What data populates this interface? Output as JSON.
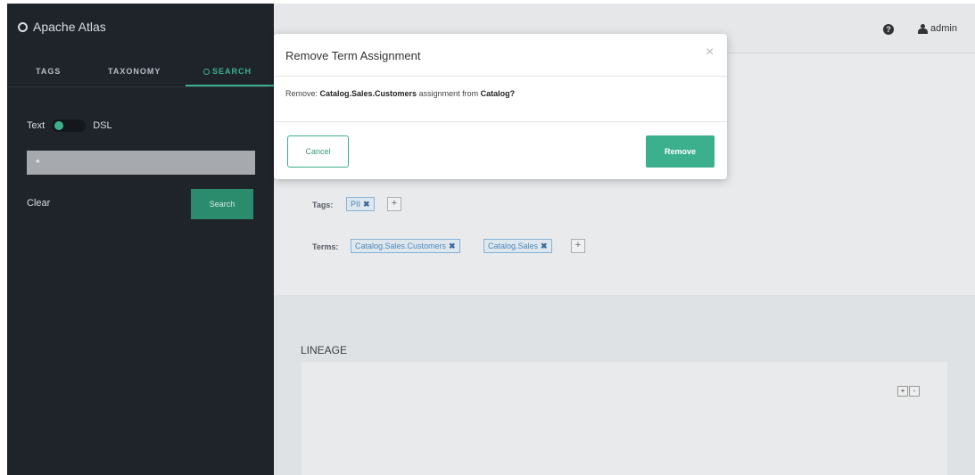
{
  "brand": {
    "name": "Apache Atlas",
    "icon": "globe-icon"
  },
  "tabs": [
    {
      "label": "TAGS"
    },
    {
      "label": "TAXONOMY"
    },
    {
      "label": "SEARCH",
      "icon": "search-icon",
      "active": true
    }
  ],
  "search": {
    "toggle_left": "Text",
    "toggle_right": "DSL",
    "query_value": "*",
    "clear_label": "Clear",
    "search_button": "Search"
  },
  "header": {
    "help_icon": "question-circle-icon",
    "user": "admin",
    "user_icon": "user-icon"
  },
  "entity": {
    "tags_label": "Tags:",
    "tags": [
      {
        "label": "PII"
      }
    ],
    "terms_label": "Terms:",
    "terms": [
      {
        "label": "Catalog.Sales.Customers"
      },
      {
        "label": "Catalog.Sales"
      }
    ],
    "add_symbol": "+",
    "remove_symbol": "✖"
  },
  "lineage": {
    "title": "LINEAGE",
    "zoom_in": "+",
    "zoom_out": "-"
  },
  "modal": {
    "title": "Remove Term Assignment",
    "close_symbol": "×",
    "body_prefix": "Remove: ",
    "body_term": "Catalog.Sales.Customers",
    "body_middle": " assignment from ",
    "body_target": "Catalog?",
    "cancel_label": "Cancel",
    "remove_label": "Remove"
  },
  "colors": {
    "accent": "#3cb08d",
    "sidebar_bg": "#1f242b",
    "chip_blue": "#4d87b8"
  }
}
